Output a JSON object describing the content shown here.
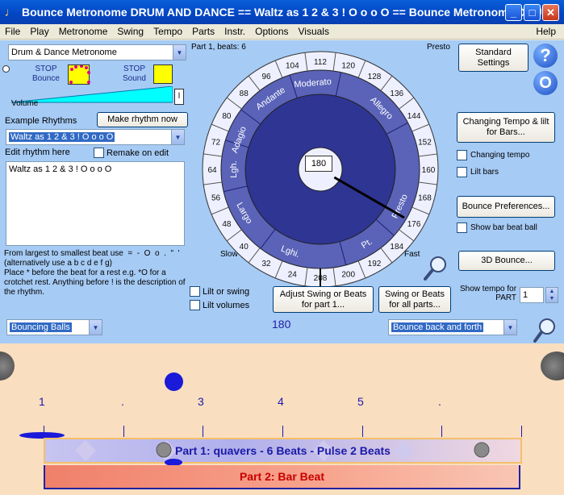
{
  "window": {
    "title": "Bounce Metronome DRUM AND DANCE == Waltz as 1 2 & 3 ! O o o O == Bounce Metronome DRU..."
  },
  "menu": [
    "File",
    "Play",
    "Metronome",
    "Swing",
    "Tempo",
    "Parts",
    "Instr.",
    "Options",
    "Visuals",
    "Help"
  ],
  "left": {
    "metronome_type": "Drum & Dance Metronome",
    "stop_bounce": "STOP\nBounce",
    "stop_sound": "STOP\nSound",
    "volume_label": "Volume",
    "volume_letter": "l",
    "example_rhythms_label": "Example Rhythms",
    "make_rhythm_button": "Make rhythm now",
    "rhythm_selected": "Waltz as 1 2 & 3 ! O o o O",
    "edit_rhythm_label": "Edit rhythm here",
    "remake_on_edit_label": "Remake on edit",
    "rhythm_text": "Waltz as 1 2 & 3 ! O o o O",
    "help_text": "From largest to smallest beat use  =  -  O  o  .  \"  '  (alternatively use a b c d e f g)\nPlace * before the beat for a rest e.g. *O for a crotchet rest. Anything before ! is the description of the rhythm."
  },
  "dial": {
    "part_label": "Part 1, beats: 6",
    "presto_corner": "Presto",
    "slow_label": "Slow",
    "fast_label": "Fast",
    "tempo_value": "180",
    "ticks": [
      "104",
      "112",
      "120",
      "128",
      "136",
      "144",
      "152",
      "160",
      "168",
      "176",
      "184",
      "192",
      "200",
      "208",
      "24",
      "32",
      "40",
      "48",
      "56",
      "64",
      "72",
      "80",
      "88",
      "96"
    ],
    "zones": [
      "Moderato",
      "Allegro",
      "Presto",
      "Pt.",
      "Lghi.",
      "Largo",
      "Lgh.",
      "Adagio",
      "Andante"
    ],
    "lilt_swing_label": "Lilt or swing",
    "lilt_volumes_label": "Lilt volumes",
    "adjust_swing_button": "Adjust Swing or Beats for part 1...",
    "swing_all_button": "Swing or Beats for all parts..."
  },
  "right": {
    "standard_settings_button": "Standard Settings",
    "help_icon_label": "?",
    "o_icon_label": "O",
    "changing_tempo_button": "Changing Tempo & lilt for Bars...",
    "changing_tempo_label": "Changing tempo",
    "lilt_bars_label": "Lilt bars",
    "bounce_prefs_button": "Bounce Preferences...",
    "show_bar_beat_ball_label": "Show bar beat ball",
    "bounce_3d_button": "3D Bounce...",
    "show_tempo_label": "Show tempo for\nPART",
    "part_number": "1"
  },
  "bounce": {
    "bouncing_mode": "Bouncing Balls",
    "bpm": "180",
    "bounce_style": "Bounce back and forth",
    "beat_numbers": [
      "1",
      ".",
      "3",
      "4",
      "5",
      "."
    ],
    "part1_label": "Part 1: quavers - 6 Beats - Pulse 2 Beats",
    "part2_label": "Part 2: Bar Beat"
  },
  "colors": {
    "panel_blue": "#a6cbf5",
    "dial_dark": "#2e3592",
    "dial_mid": "#5a63b8",
    "bounce_bg": "#f9dec0",
    "stop_yellow": "#ffff00"
  }
}
